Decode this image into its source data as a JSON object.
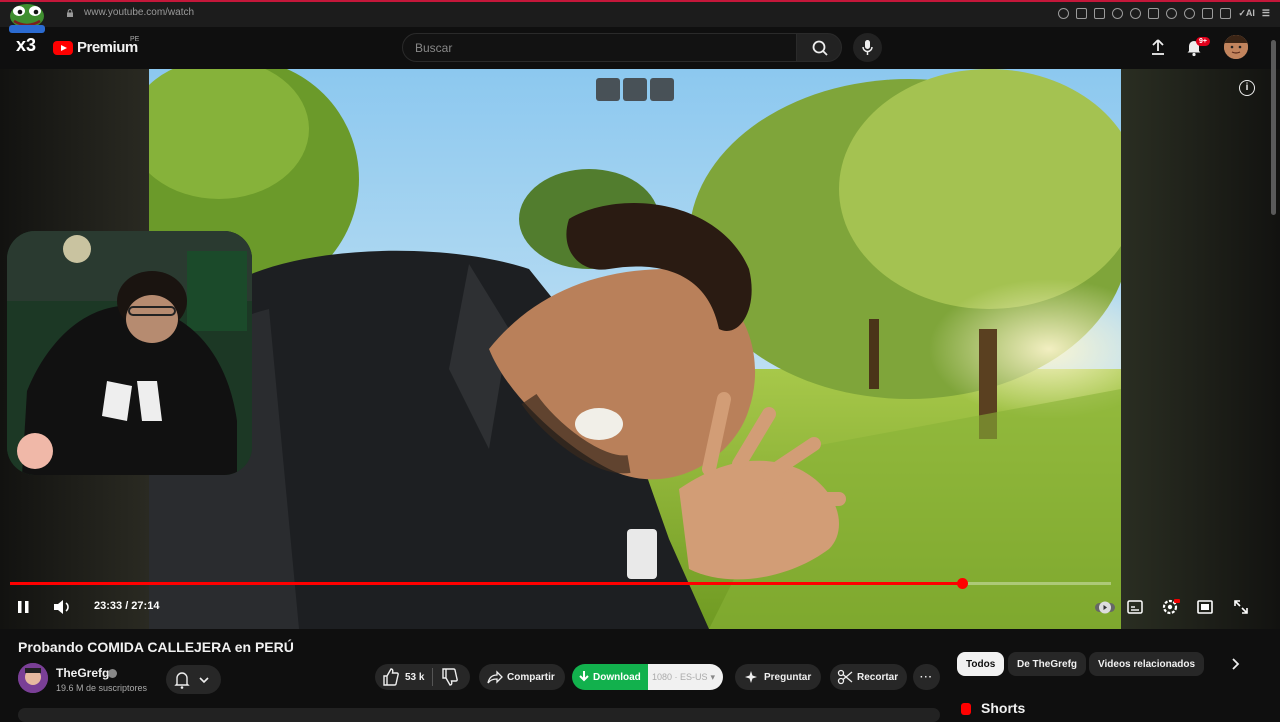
{
  "browser": {
    "url": "www.youtube.com/watch"
  },
  "header": {
    "logo_text": "Premium",
    "country_code": "PE",
    "search_placeholder": "Buscar",
    "notifications_badge": "9+"
  },
  "player": {
    "time": "23:33 / 27:14",
    "progress_fraction": 0.865,
    "accent": "#ff0000"
  },
  "video": {
    "title": "Probando COMIDA CALLEJERA en PERÚ",
    "channel": "TheGrefg",
    "subscribers": "19.6 M de suscriptores"
  },
  "actions": {
    "likes": "53 k",
    "share": "Compartir",
    "download": "Download",
    "download_quality": "1080 · ES-US",
    "ask": "Preguntar",
    "clip": "Recortar",
    "more": "···"
  },
  "chips": [
    "Todos",
    "De TheGrefg",
    "Videos relacionados"
  ],
  "shorts": {
    "title": "Shorts"
  },
  "overlay": {
    "streamer_badge": "x3"
  }
}
